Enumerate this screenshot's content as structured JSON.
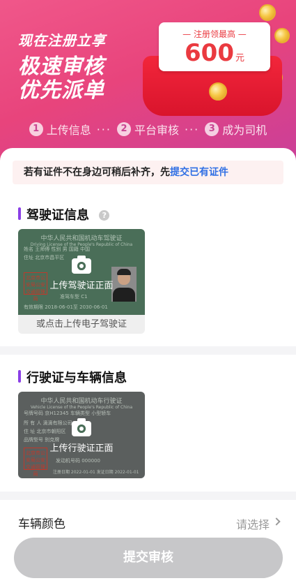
{
  "banner": {
    "line1": "现在注册立享",
    "line2": "极速审核",
    "line3": "优先派单",
    "ticket_label": "— 注册领最高 —",
    "ticket_amount": "600",
    "ticket_unit": "元"
  },
  "steps": [
    {
      "num": "1",
      "label": "上传信息"
    },
    {
      "num": "2",
      "label": "平台审核"
    },
    {
      "num": "3",
      "label": "成为司机"
    }
  ],
  "steps_separator": "···",
  "notice": {
    "text": "若有证件不在身边可稍后补齐，先",
    "link": "提交已有证件"
  },
  "driver_license": {
    "title": "驾驶证信息",
    "help": "?",
    "doc_title": "中华人民共和国机动车驾驶证",
    "doc_sub": "Driving License of the People's Republic of China",
    "row_name": "姓名  王师傅     性别 男     国籍  中国",
    "row_addr": "住址  北京市昌平区",
    "row_class": "准驾车型   C1",
    "row_date": "有效期限  2018-06-01至  2030-06-01",
    "stamp": "北京市公安局公安交通管理局",
    "upload_text": "上传驾驶证正面",
    "caption": "或点击上传电子驾驶证"
  },
  "vehicle_license": {
    "title": "行驶证与车辆信息",
    "doc_title": "中华人民共和国机动车行驶证",
    "doc_sub": "Vehicle License of the People's Republic of China",
    "row_plate": "号牌号码  京H12345     车辆类型  小型轿车",
    "row_owner": "所 有 人  滴滴有限公司",
    "row_addr": "住    址  北京市朝阳区",
    "row_model": "品牌型号  别克牌",
    "row_engine": "发动机号码   000000",
    "row_date": "注册日期 2022-01-01   发证日期 2022-01-01",
    "stamp": "北京市公安局公安交通管理局",
    "upload_text": "上传行驶证正面"
  },
  "vehicle_color": {
    "label": "车辆颜色",
    "placeholder": "请选择"
  },
  "submit_label": "提交审核",
  "colors": {
    "accent": "#e8447c",
    "title_bar": "#8a3fe6",
    "link": "#2f6fe4",
    "disabled": "#c7c7c9"
  }
}
